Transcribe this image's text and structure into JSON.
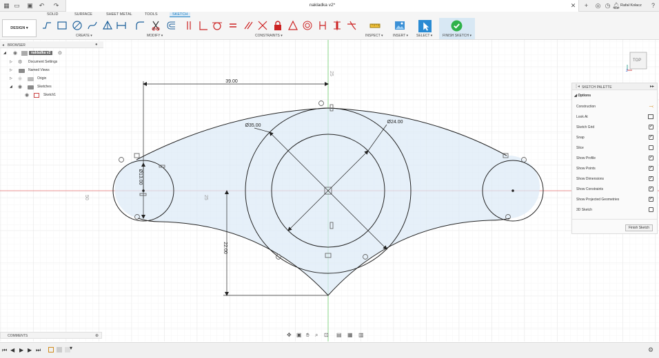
{
  "title_bar": {
    "document_title": "nakladka v2*",
    "user_name": "Rafał Kołacz",
    "icons": [
      "grid-icon",
      "file-icon",
      "save-icon",
      "undo-icon",
      "redo-icon",
      "close-icon",
      "add-tab-icon",
      "job-status-icon",
      "clock-icon",
      "notification-icon",
      "help-icon"
    ]
  },
  "workspace_tabs": [
    {
      "label": "SOLID",
      "active": false
    },
    {
      "label": "SURFACE",
      "active": false
    },
    {
      "label": "SHEET METAL",
      "active": false
    },
    {
      "label": "TOOLS",
      "active": false
    },
    {
      "label": "SKETCH",
      "active": true
    }
  ],
  "toolbar": {
    "design_label": "DESIGN ▾",
    "groups": {
      "create": "CREATE ▾",
      "modify": "MODIFY ▾",
      "constraints": "CONSTRAINTS ▾",
      "inspect": "INSPECT ▾",
      "insert": "INSERT ▾",
      "select": "SELECT ▾",
      "finish": "FINISH SKETCH ▾"
    }
  },
  "browser": {
    "header": "BROWSER",
    "items": [
      {
        "label": "nakladka v2",
        "level": 0
      },
      {
        "label": "Document Settings",
        "level": 1
      },
      {
        "label": "Named Views",
        "level": 1
      },
      {
        "label": "Origin",
        "level": 1
      },
      {
        "label": "Sketches",
        "level": 1
      },
      {
        "label": "Sketch1",
        "level": 2
      }
    ]
  },
  "sketch_palette": {
    "header": "SKETCH PALETTE",
    "section": "Options",
    "options": [
      {
        "label": "Construction",
        "control": "icon"
      },
      {
        "label": "Look At",
        "control": "icon"
      },
      {
        "label": "Sketch Grid",
        "checked": true
      },
      {
        "label": "Snap",
        "checked": true
      },
      {
        "label": "Slice",
        "checked": false
      },
      {
        "label": "Show Profile",
        "checked": true
      },
      {
        "label": "Show Points",
        "checked": true
      },
      {
        "label": "Show Dimensions",
        "checked": true
      },
      {
        "label": "Show Constraints",
        "checked": true
      },
      {
        "label": "Show Projected Geometries",
        "checked": true
      },
      {
        "label": "3D Sketch",
        "checked": false
      }
    ],
    "finish_button": "Finish Sketch"
  },
  "comments": {
    "label": "COMMENTS"
  },
  "viewcube": {
    "label": "TOP"
  },
  "canvas": {
    "dimensions": {
      "width": "39.00",
      "big_circle": "Ø35.00",
      "inner_circle": "Ø24.00",
      "small_circle": "Ø13.00",
      "height": "22.00"
    },
    "ruler_labels": {
      "top": "25",
      "left": "50",
      "mid": "25"
    }
  },
  "colors": {
    "accent": "#1b7ec2",
    "profile_fill": "#dbeaf6",
    "finish_green": "#2fb24a",
    "constraint_red": "#cc2222"
  }
}
